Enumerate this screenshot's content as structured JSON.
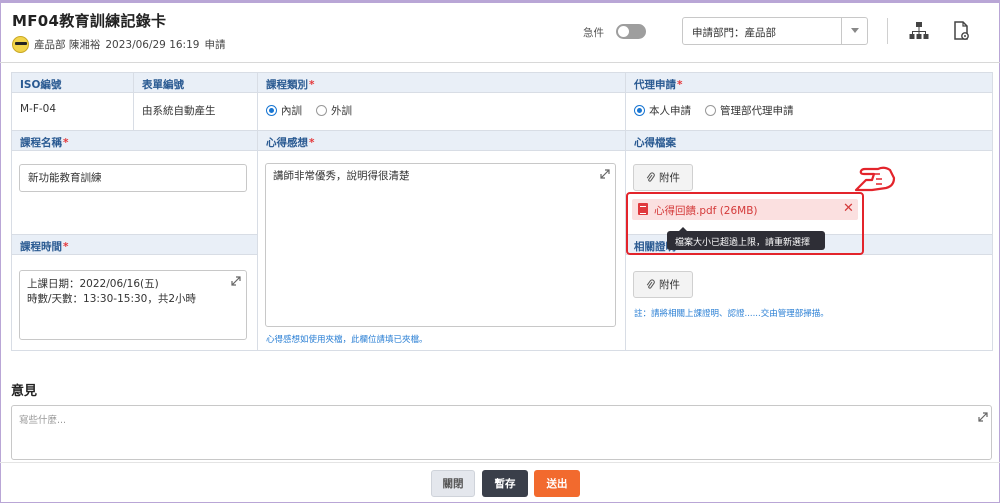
{
  "header": {
    "title": "MF04教育訓練記錄卡",
    "applicant": "產品部 陳湘裕",
    "datetime": "2023/06/29 16:19",
    "status": "申請",
    "urgent_label": "急件",
    "urgent_on": false,
    "dept_select": "申請部門：產品部"
  },
  "form": {
    "iso_no": {
      "label": "ISO編號",
      "value": "M-F-04"
    },
    "form_no": {
      "label": "表單編號",
      "value": "由系統自動產生"
    },
    "course_type": {
      "label": "課程類別",
      "options": [
        "內訓",
        "外訓"
      ],
      "selected": "內訓"
    },
    "proxy": {
      "label": "代理申請",
      "options": [
        "本人申請",
        "管理部代理申請"
      ],
      "selected": "本人申請"
    },
    "course_name": {
      "label": "課程名稱",
      "value": "新功能教育訓練"
    },
    "reflection": {
      "label": "心得感想",
      "value": "講師非常優秀，說明得很清楚",
      "note": "心得感想如使用夾檔，此欄位請填已夾檔。"
    },
    "reflection_file": {
      "label": "心得檔案",
      "attach_label": "附件",
      "file_name": "心得回饋.pdf (26MB)",
      "error_tooltip": "檔案大小已超過上限，請重新選擇"
    },
    "course_time": {
      "label": "課程時間",
      "line1": "上課日期：2022/06/16(五)",
      "line2": "時數/天數：13:30-15:30，共2小時"
    },
    "proof": {
      "label": "相關證明",
      "attach_label": "附件",
      "note": "註：請將相關上課證明、認證......交由管理部掃描。"
    }
  },
  "opinion": {
    "title": "意見",
    "placeholder": "寫些什麼..."
  },
  "footer": {
    "close_label": "關閉",
    "save_label": "暫存",
    "submit_label": "送出"
  },
  "colors": {
    "accent_blue": "#1976d2",
    "header_bg": "#e9eff7",
    "error_red": "#e3242b",
    "submit_orange": "#f26a2e",
    "save_dark": "#3a3f4a"
  }
}
